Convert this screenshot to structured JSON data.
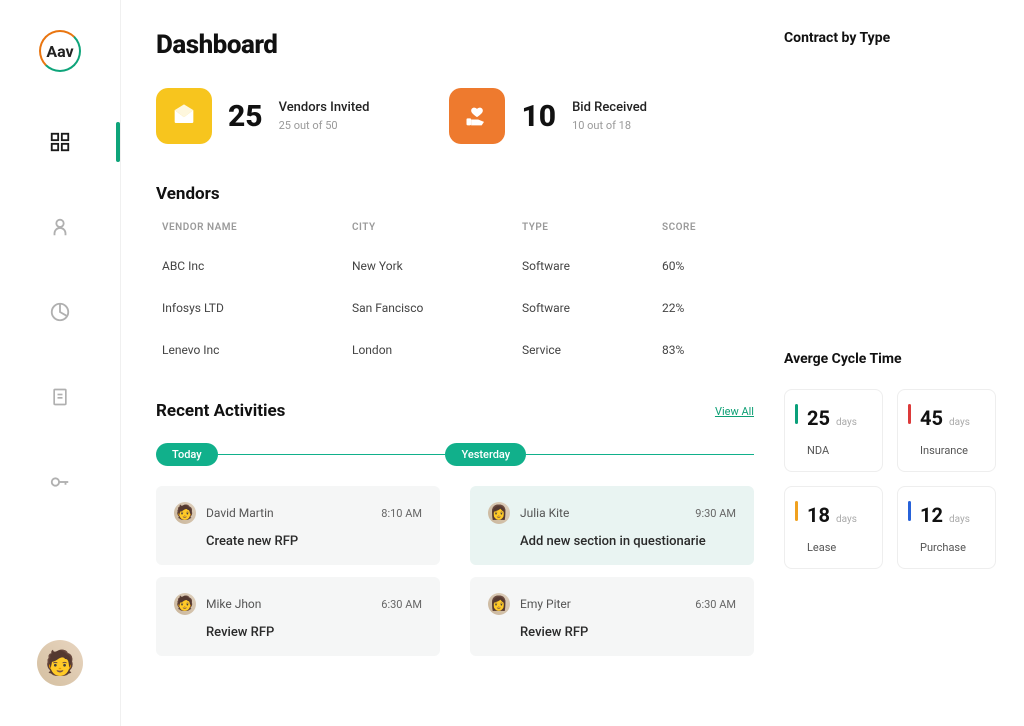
{
  "logo": "Aav",
  "page_title": "Dashboard",
  "kpis": [
    {
      "value": "25",
      "label": "Vendors Invited",
      "sub": "25 out of 50"
    },
    {
      "value": "10",
      "label": "Bid Received",
      "sub": "10 out of 18"
    }
  ],
  "vendors": {
    "title": "Vendors",
    "headers": {
      "name": "VENDOR NAME",
      "city": "CITY",
      "type": "TYPE",
      "score": "SCORE"
    },
    "rows": [
      {
        "name": "ABC Inc",
        "city": "New York",
        "type": "Software",
        "score": "60%"
      },
      {
        "name": "Infosys LTD",
        "city": "San Fancisco",
        "type": "Software",
        "score": "22%"
      },
      {
        "name": "Lenevo Inc",
        "city": "London",
        "type": "Service",
        "score": "83%"
      }
    ]
  },
  "activities": {
    "title": "Recent Activities",
    "view_all": "View All",
    "today_label": "Today",
    "yesterday_label": "Yesterday",
    "today": [
      {
        "user": "David Martin",
        "time": "8:10 AM",
        "desc": "Create new RFP"
      },
      {
        "user": "Mike Jhon",
        "time": "6:30 AM",
        "desc": "Review  RFP"
      }
    ],
    "yesterday": [
      {
        "user": "Julia Kite",
        "time": "9:30 AM",
        "desc": "Add new section in questionarie"
      },
      {
        "user": "Emy Piter",
        "time": "6:30 AM",
        "desc": "Review  RFP"
      }
    ]
  },
  "contract_title": "Contract  by Type",
  "cycle": {
    "title": "Averge Cycle Time",
    "days_label": "days",
    "cards": [
      {
        "num": "25",
        "label": "NDA"
      },
      {
        "num": "45",
        "label": "Insurance"
      },
      {
        "num": "18",
        "label": "Lease"
      },
      {
        "num": "12",
        "label": "Purchase"
      }
    ]
  }
}
